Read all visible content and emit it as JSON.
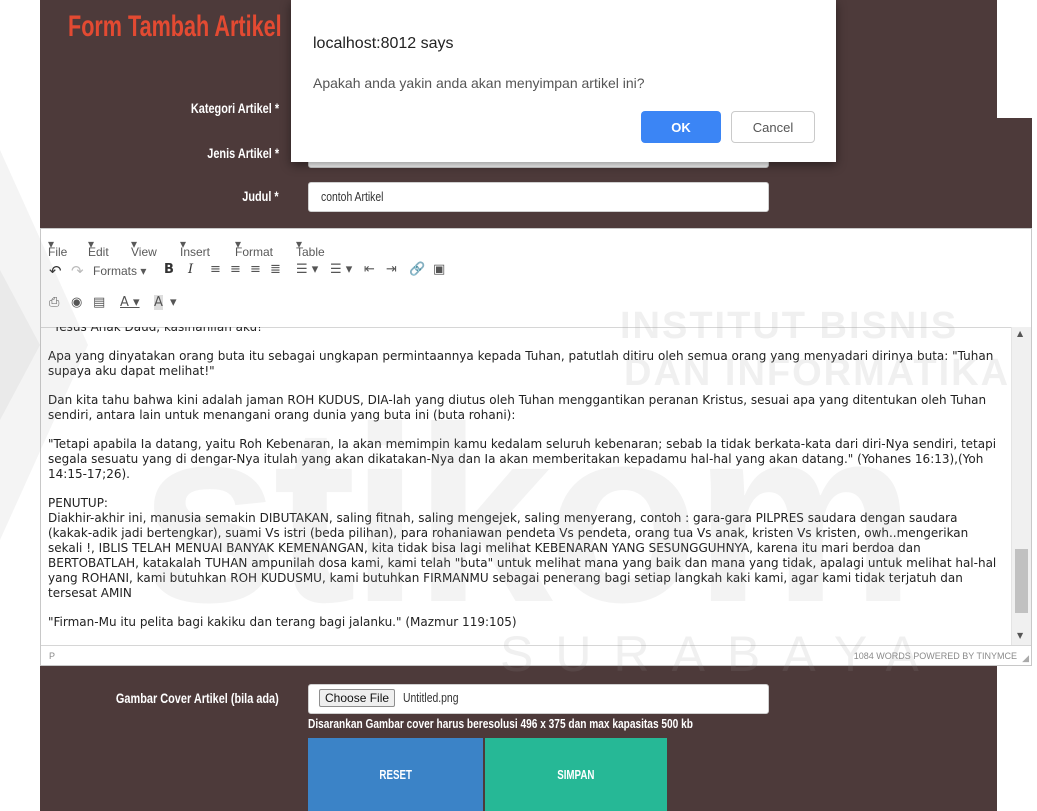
{
  "form": {
    "title": "Form Tambah Artikel",
    "labels": {
      "kategori": "Kategori Artikel *",
      "jenis": "Jenis Artikel *",
      "judul": "Judul *",
      "gambar": "Gambar Cover Artikel (bila ada)"
    },
    "judul_value": "contoh Artikel",
    "file_button": "Choose File",
    "file_name": "Untitled.png",
    "hint": "Disarankan Gambar cover harus beresolusi 496 x 375 dan max kapasitas 500 kb",
    "reset_label": "RESET",
    "simpan_label": "SIMPAN"
  },
  "editor": {
    "menus": [
      "File",
      "Edit",
      "View",
      "Insert",
      "Format",
      "Table"
    ],
    "formats_label": "Formats",
    "content": [
      "\"Yesus Anak Daud, kasihanilah aku!\"",
      "Apa yang dinyatakan orang buta itu sebagai ungkapan permintaannya kepada Tuhan, patutlah ditiru oleh semua orang yang menyadari dirinya buta: \"Tuhan supaya aku dapat melihat!\"",
      "Dan kita tahu bahwa kini adalah jaman ROH KUDUS, DIA-lah yang diutus oleh Tuhan menggantikan peranan Kristus, sesuai apa yang ditentukan oleh Tuhan sendiri, antara lain untuk menangani orang dunia yang buta ini (buta rohani):",
      "\"Tetapi apabila Ia datang, yaitu Roh Kebenaran, Ia akan memimpin kamu kedalam seluruh kebenaran; sebab Ia tidak berkata-kata dari diri-Nya sendiri, tetapi segala sesuatu yang di dengar-Nya itulah yang akan dikatakan-Nya dan Ia akan memberitakan kepadamu hal-hal yang akan datang.\" (Yohanes 16:13),(Yoh 14:15-17;26).",
      "PENUTUP:",
      "Diakhir-akhir ini, manusia semakin DIBUTAKAN, saling fitnah, saling mengejek, saling menyerang, contoh : gara-gara PILPRES saudara dengan saudara (kakak-adik jadi bertengkar), suami Vs istri (beda pilihan), para rohaniawan pendeta Vs pendeta, orang tua Vs anak, kristen Vs kristen, owh..mengerikan sekali !, IBLIS TELAH MENUAI BANYAK KEMENANGAN, kita tidak bisa lagi melihat KEBENARAN YANG SESUNGGUHNYA, karena itu mari berdoa dan BERTOBATLAH, katakalah TUHAN ampunilah dosa kami, kami telah \"buta\" untuk melihat mana yang baik dan mana yang tidak, apalagi untuk melihat hal-hal yang ROHANI, kami butuhkan ROH KUDUSMU, kami butuhkan FIRMANMU sebagai penerang bagi setiap langkah kaki kami, agar kami tidak terjatuh dan tersesat AMIN",
      "\"Firman-Mu itu pelita bagi kakiku dan terang bagi jalanku.\" (Mazmur 119:105)"
    ],
    "status_path": "P",
    "word_count": "1084 WORDS POWERED BY TINYMCE"
  },
  "dialog": {
    "title": "localhost:8012 says",
    "message": "Apakah anda yakin anda akan menyimpan artikel ini?",
    "ok_label": "OK",
    "cancel_label": "Cancel"
  },
  "watermark": {
    "line1": "INSTITUT BISNIS",
    "line2": "DAN INFORMATIKA",
    "logo": "stikom",
    "city": "SURABAYA"
  },
  "colors": {
    "panel": "#4d3a3a",
    "title": "#e34a32",
    "reset": "#3b83c7",
    "simpan": "#26b896",
    "ok": "#3b85f5"
  }
}
